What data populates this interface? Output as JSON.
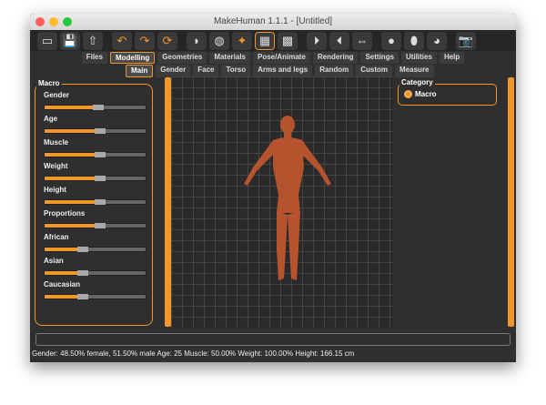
{
  "window": {
    "title": "MakeHuman 1.1.1 - [Untitled]"
  },
  "toolbar": {
    "icons": [
      "new-icon",
      "save-icon",
      "export-icon",
      "undo-icon",
      "redo-icon",
      "reset-icon",
      "smooth-icon",
      "wireframe-icon",
      "pose-icon",
      "grid-icon",
      "checker-icon",
      "symmetry-right-icon",
      "symmetry-left-icon",
      "symmetry-icon",
      "front-view-icon",
      "side-view-icon",
      "top-view-icon",
      "screenshot-icon"
    ]
  },
  "tabs": [
    "Files",
    "Modelling",
    "Geometries",
    "Materials",
    "Pose/Animate",
    "Rendering",
    "Settings",
    "Utilities",
    "Help"
  ],
  "selected_tab": "Modelling",
  "subtabs": [
    "Main",
    "Gender",
    "Face",
    "Torso",
    "Arms and legs",
    "Random",
    "Custom",
    "Measure"
  ],
  "selected_subtab": "Main",
  "macro": {
    "title": "Macro",
    "sliders": [
      {
        "label": "Gender",
        "value": 0.485
      },
      {
        "label": "Age",
        "value": 0.5
      },
      {
        "label": "Muscle",
        "value": 0.5
      },
      {
        "label": "Weight",
        "value": 0.5
      },
      {
        "label": "Height",
        "value": 0.5
      },
      {
        "label": "Proportions",
        "value": 0.5
      },
      {
        "label": "African",
        "value": 0.333
      },
      {
        "label": "Asian",
        "value": 0.333
      },
      {
        "label": "Caucasian",
        "value": 0.333
      }
    ]
  },
  "category": {
    "title": "Category",
    "option": "Macro"
  },
  "status": "Gender: 48.50% female, 51.50% male Age: 25 Muscle: 50.00% Weight: 100.00% Height: 166.15 cm",
  "colors": {
    "accent": "#f0962a",
    "skin": "#b5532f"
  }
}
